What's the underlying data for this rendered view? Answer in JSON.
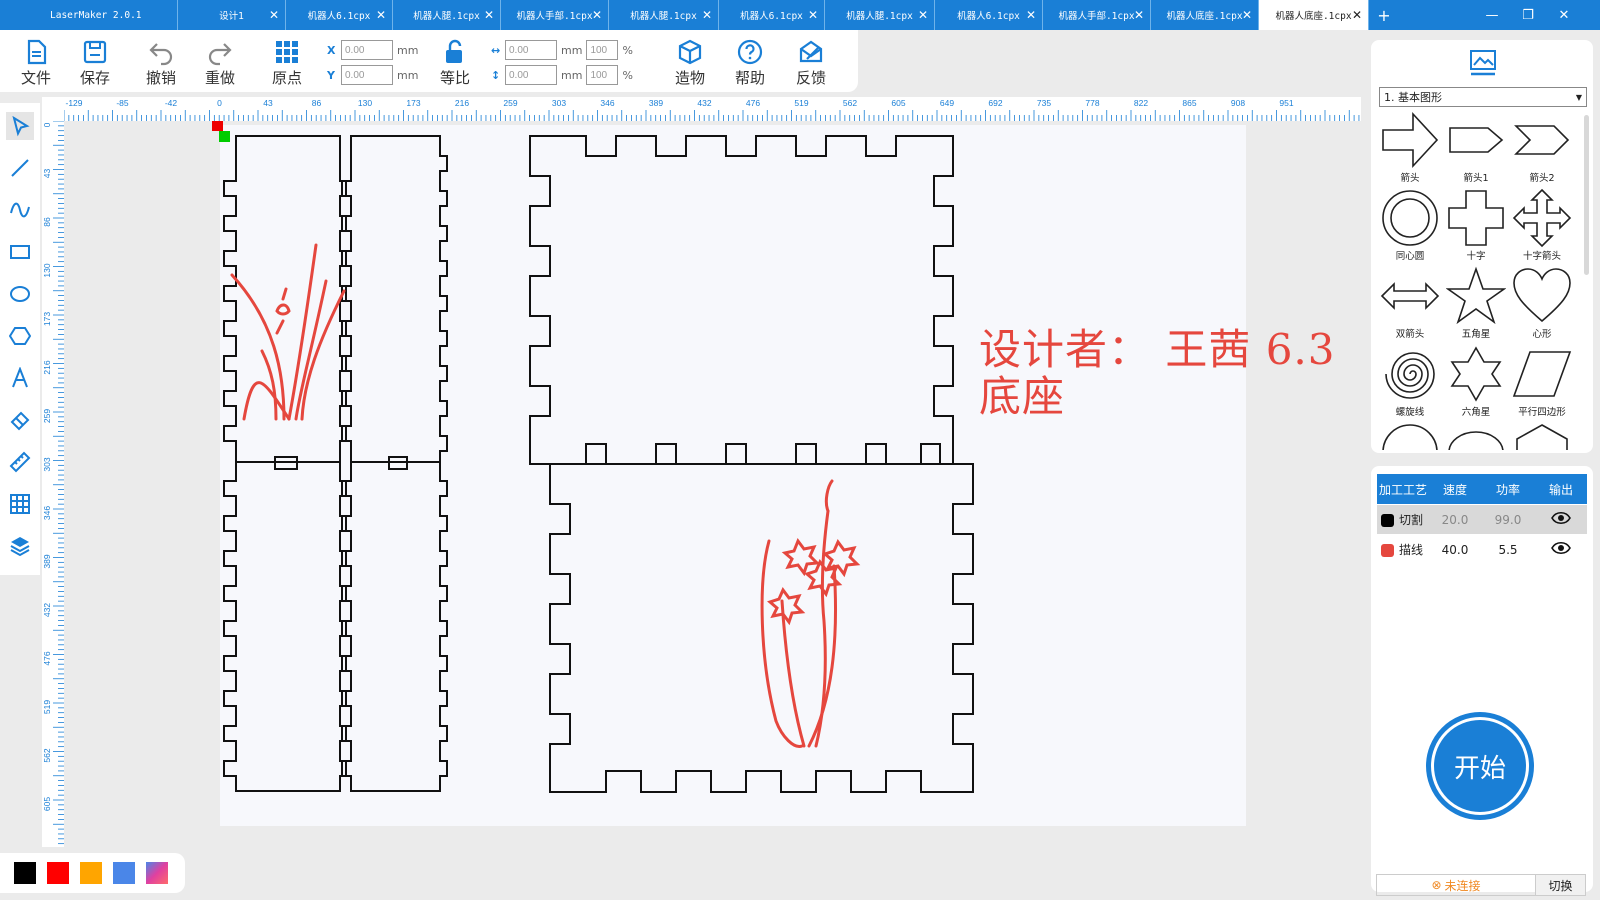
{
  "tabs": [
    {
      "label": "LaserMaker 2.0.1",
      "closable": false,
      "active": false,
      "w": 178
    },
    {
      "label": "设计1",
      "closable": true,
      "active": false,
      "w": 108
    },
    {
      "label": "机器人6.1cpx",
      "closable": true,
      "active": false,
      "w": 107
    },
    {
      "label": "机器人腿.1cpx",
      "closable": true,
      "active": false,
      "w": 108
    },
    {
      "label": "机器人手部.1cpx",
      "closable": true,
      "active": false,
      "w": 108
    },
    {
      "label": "机器人腿.1cpx",
      "closable": true,
      "active": false,
      "w": 110
    },
    {
      "label": "机器人6.1cpx",
      "closable": true,
      "active": false,
      "w": 106
    },
    {
      "label": "机器人腿.1cpx",
      "closable": true,
      "active": false,
      "w": 110
    },
    {
      "label": "机器人6.1cpx",
      "closable": true,
      "active": false,
      "w": 108
    },
    {
      "label": "机器人手部.1cpx",
      "closable": true,
      "active": false,
      "w": 108
    },
    {
      "label": "机器人底座.1cpx",
      "closable": true,
      "active": false,
      "w": 108
    },
    {
      "label": "机器人底座.1cpx",
      "closable": true,
      "active": true,
      "w": 110
    }
  ],
  "toolbar": {
    "file": "文件",
    "save": "保存",
    "undo": "撤销",
    "redo": "重做",
    "origin": "原点",
    "ratio": "等比",
    "build": "造物",
    "help": "帮助",
    "feedback": "反馈",
    "x_label": "X",
    "y_label": "Y",
    "x_value": "0.00",
    "y_value": "0.00",
    "w_value": "0.00",
    "h_value": "0.00",
    "w_pct": "100",
    "h_pct": "100",
    "unit": "mm",
    "pct": "%"
  },
  "ruler_h": [
    "-129",
    "-85",
    "-42",
    "0",
    "43",
    "86",
    "130",
    "173",
    "216",
    "259",
    "303",
    "346",
    "389",
    "432",
    "476",
    "519",
    "562",
    "605",
    "649",
    "692",
    "735",
    "778",
    "822",
    "865",
    "908",
    "951"
  ],
  "ruler_v": [
    "0",
    "43",
    "86",
    "130",
    "173",
    "216",
    "259",
    "303",
    "346",
    "389",
    "432",
    "476",
    "519",
    "562",
    "605"
  ],
  "canvas": {
    "designer_line1": "设计者： 王茜  6.3",
    "designer_line2": "底座"
  },
  "palette": [
    "#000000",
    "#ff0000",
    "#ffa500",
    "#4a86e8",
    "gradient"
  ],
  "shapes_panel": {
    "category": "1. 基本图形",
    "shapes": [
      "箭头",
      "箭头1",
      "箭头2",
      "同心圆",
      "十字",
      "十字箭头",
      "双箭头",
      "五角星",
      "心形",
      "螺旋线",
      "六角星",
      "平行四边形"
    ]
  },
  "layers": {
    "headers": [
      "加工工艺",
      "速度",
      "功率",
      "输出"
    ],
    "rows": [
      {
        "color": "#000000",
        "name": "切割",
        "speed": "20.0",
        "power": "99.0"
      },
      {
        "color": "#e5473e",
        "name": "描线",
        "speed": "40.0",
        "power": "5.5"
      }
    ]
  },
  "start_label": "开始",
  "connection": {
    "status": "未连接",
    "switch": "切换"
  }
}
